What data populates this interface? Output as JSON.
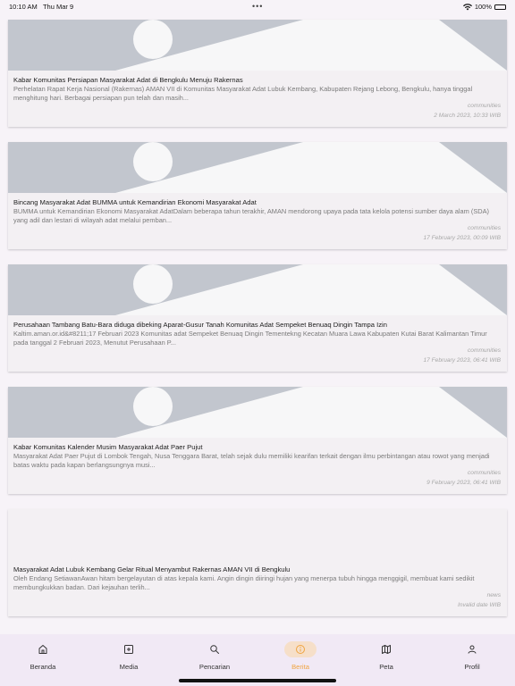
{
  "status_bar": {
    "time": "10:10 AM",
    "date": "Thu Mar 9",
    "center_dots": "•••",
    "battery": "100%"
  },
  "articles": [
    {
      "title": "Kabar Komunitas Persiapan Masyarakat Adat di Bengkulu Menuju Rakernas",
      "summary": "Perhelatan Rapat Kerja Nasional (Rakernas) AMAN VII di Komunitas Masyarakat Adat Lubuk Kembang, Kabupaten Rejang Lebong, Bengkulu, hanya tinggal menghitung hari. Berbagai persiapan pun telah dan masih...",
      "category": "communities",
      "date": "2 March 2023, 10:33 WIB",
      "has_image": true
    },
    {
      "title": "Bincang Masyarakat Adat BUMMA untuk Kemandirian Ekonomi Masyarakat Adat",
      "summary": "BUMMA untuk Kemandirian Ekonomi Masyarakat AdatDalam beberapa tahun terakhir, AMAN mendorong upaya pada tata kelola potensi sumber daya alam (SDA) yang adil dan lestari di wilayah adat melalui pemban...",
      "category": "communities",
      "date": "17 February 2023, 00:09 WIB",
      "has_image": true
    },
    {
      "title": "Perusahaan Tambang Batu-Bara diduga dibeking Aparat-Gusur Tanah Komunitas Adat Sempeket Benuaq Dingin Tampa Izin",
      "summary": "Kaltim.aman.or.id&#8211;17 Februari 2023 Komunitas adat Sempeket Benuaq Dingin Tementekng Kecatan Muara Lawa Kabupaten  Kutai Barat Kalimantan Timur pada tanggal 2 Februari 2023, Menutut Perusahaan P...",
      "category": "communities",
      "date": "17 February 2023, 06:41 WIB",
      "has_image": true
    },
    {
      "title": "Kabar Komunitas Kalender Musim Masyarakat Adat Paer Pujut",
      "summary": "Masyarakat Adat Paer Pujut di Lombok Tengah, Nusa Tenggara Barat, telah sejak dulu memiliki kearifan terkait dengan ilmu perbintangan atau rowot yang menjadi batas waktu pada kapan berlangsungnya musi...",
      "category": "communities",
      "date": "9 February 2023, 06:41 WIB",
      "has_image": true
    },
    {
      "title": "Masyarakat Adat Lubuk Kembang Gelar Ritual Menyambut Rakernas AMAN VII di Bengkulu",
      "summary": "Oleh Endang SetiawanAwan hitam bergelayutan di atas kepala kami. Angin dingin diiringi hujan yang menerpa tubuh hingga menggigil, membuat kami sedikit membungkukkan badan. Dari kejauhan terlih...",
      "category": "news",
      "date": "Invalid date WIB",
      "has_image": false
    }
  ],
  "bottom_nav": [
    {
      "label": "Beranda",
      "icon": "home-icon",
      "active": false
    },
    {
      "label": "Media",
      "icon": "add-box-icon",
      "active": false
    },
    {
      "label": "Pencarian",
      "icon": "search-icon",
      "active": false
    },
    {
      "label": "Berita",
      "icon": "info-icon",
      "active": true
    },
    {
      "label": "Peta",
      "icon": "map-icon",
      "active": false
    },
    {
      "label": "Profil",
      "icon": "person-icon",
      "active": false
    }
  ],
  "colors": {
    "accent": "#f0a441",
    "placeholder_bg": "#c2c6ce",
    "placeholder_shape": "#f7f7f8",
    "nav_bg": "#f1e9f5"
  }
}
